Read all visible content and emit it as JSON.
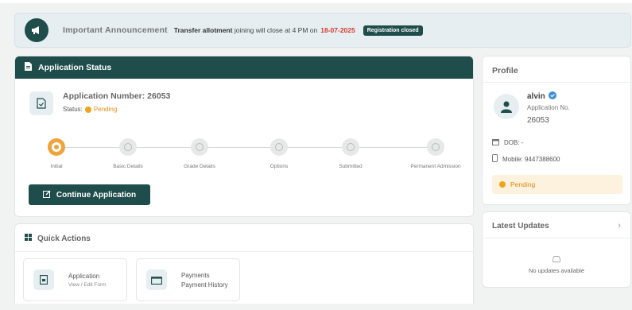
{
  "announcement": {
    "title": "Important Announcement",
    "message_bold": "Transfer allotment",
    "message_rest": "joining will close at 4 PM on",
    "date": "18-07-2025",
    "badge": "Registration closed"
  },
  "application": {
    "header": "Application Status",
    "number_label": "Application Number: 26053",
    "status_label": "Status:",
    "status_value": "Pending",
    "steps": [
      {
        "label": "Initial",
        "active": true
      },
      {
        "label": "Basic Details",
        "active": false
      },
      {
        "label": "Grade Details",
        "active": false
      },
      {
        "label": "Options",
        "active": false
      },
      {
        "label": "Submitted",
        "active": false
      },
      {
        "label": "Permanent Admission",
        "active": false
      }
    ],
    "continue_label": "Continue Application"
  },
  "quick_actions": {
    "title": "Quick Actions",
    "items": [
      {
        "title": "Application",
        "subtitle": "View / Edit Form"
      },
      {
        "title": "Payments",
        "subtitle": "Payment History"
      }
    ]
  },
  "profile": {
    "title": "Profile",
    "name": "alvin",
    "app_no_label": "Application No.",
    "app_no": "26053",
    "dob": "DOB: -",
    "mobile": "Mobile: 9447388600",
    "status": "Pending"
  },
  "updates": {
    "title": "Latest Updates",
    "empty": "No updates available"
  },
  "colors": {
    "primary": "#1e4d4b",
    "pending": "#f2a31b",
    "date_red": "#d43b2f"
  }
}
